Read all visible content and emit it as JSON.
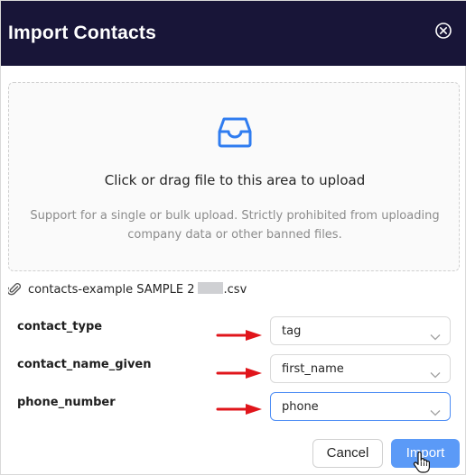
{
  "modal": {
    "title": "Import Contacts"
  },
  "upload": {
    "main_text": "Click or drag file to this area to upload",
    "hint": "Support for a single or bulk upload. Strictly prohibited from uploading company data or other banned files."
  },
  "file": {
    "name_prefix": "contacts-example SAMPLE 2",
    "name_suffix": ".csv"
  },
  "mappings": [
    {
      "label": "contact_type",
      "value": "tag"
    },
    {
      "label": "contact_name_given",
      "value": "first_name"
    },
    {
      "label": "phone_number",
      "value": "phone"
    }
  ],
  "footer": {
    "cancel_label": "Cancel",
    "import_label": "Import"
  },
  "colors": {
    "header_bg": "#181538",
    "accent": "#5b9af7",
    "annotation_arrow": "#e0151b"
  },
  "icons": [
    "close-icon",
    "inbox-icon",
    "paperclip-icon",
    "chevron-down-icon",
    "hand-cursor-icon"
  ]
}
